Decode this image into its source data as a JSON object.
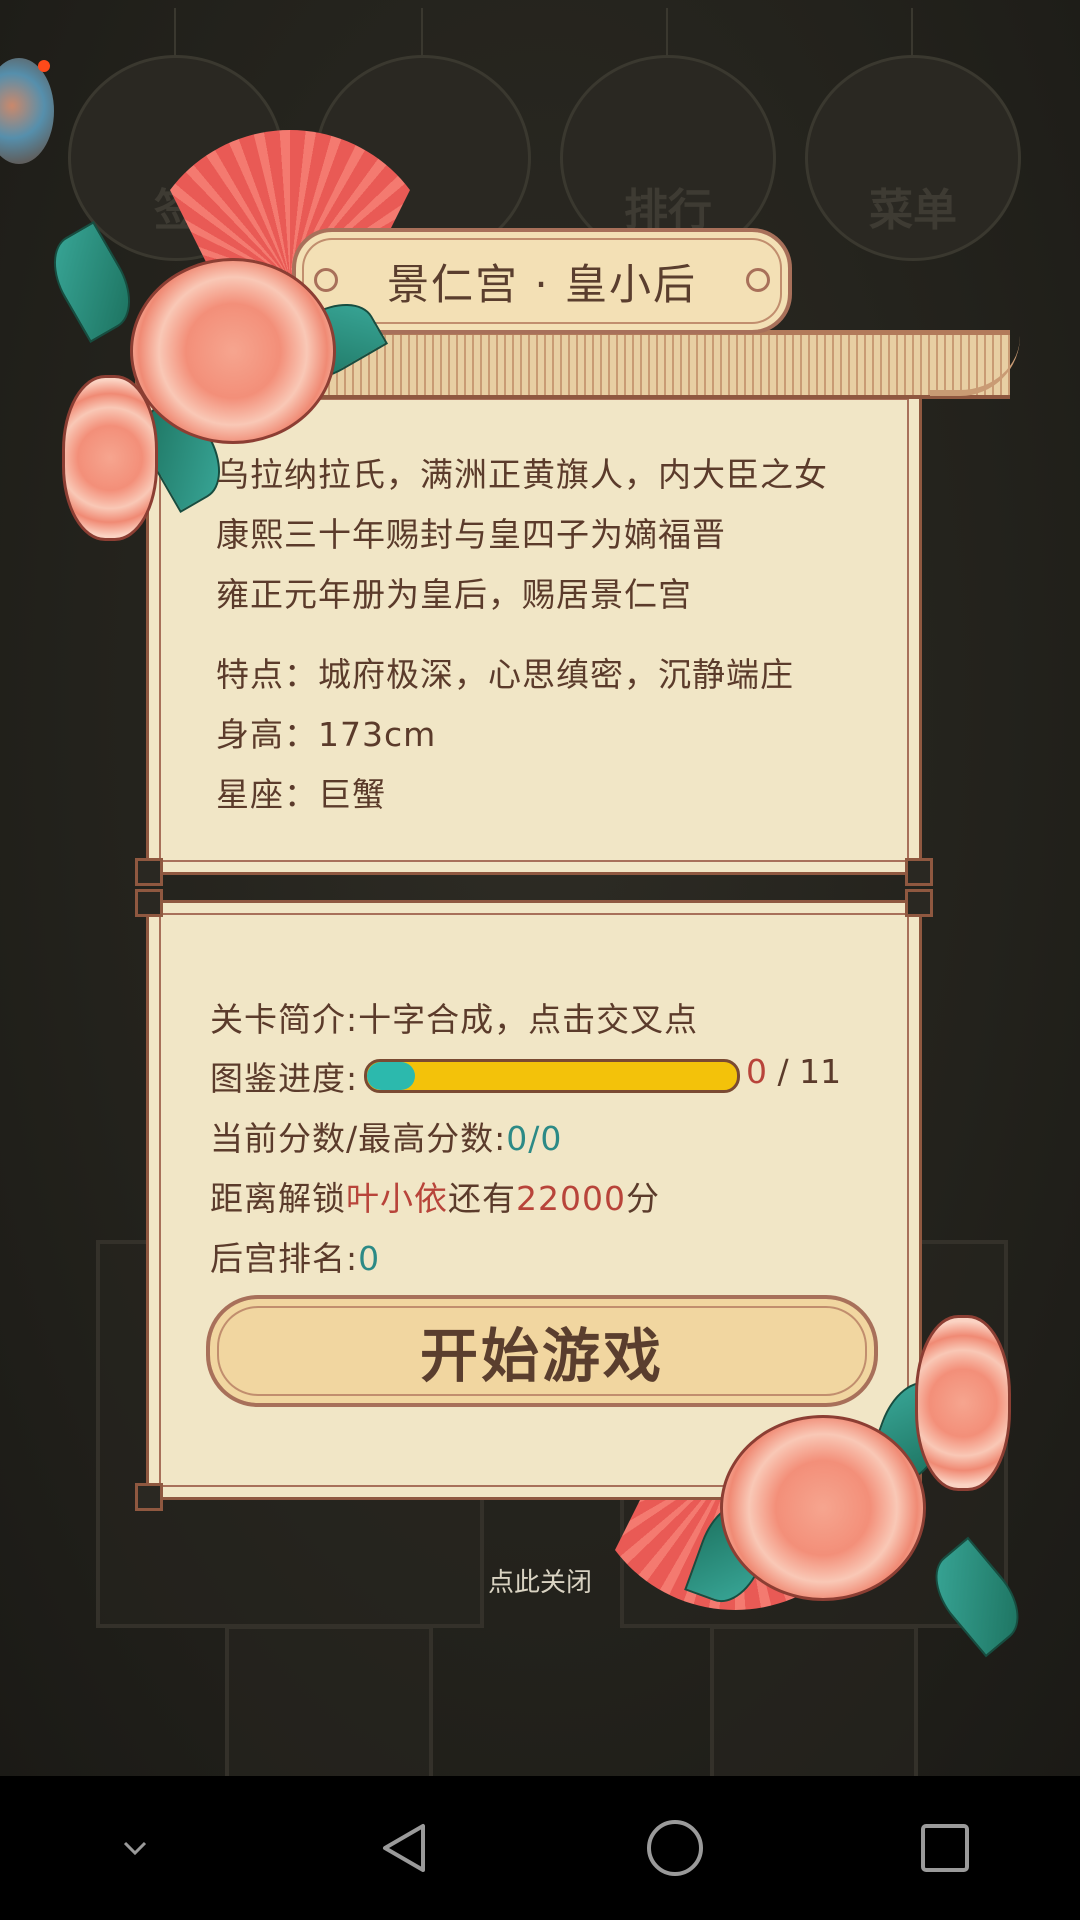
{
  "background": {
    "lanterns": [
      "签",
      "",
      "排行",
      "菜单"
    ]
  },
  "header": {
    "title": "景仁宫 · 皇小后"
  },
  "bio": {
    "line1": "乌拉纳拉氏，满洲正黄旗人，内大臣之女",
    "line2": "康熙三十年赐封与皇四子为嫡福晋",
    "line3": "雍正元年册为皇后，赐居景仁宫",
    "trait": "特点：城府极深，心思缜密，沉静端庄",
    "height": "身高：173cm",
    "zodiac": "星座：巨蟹"
  },
  "level": {
    "intro_label": "关卡简介:",
    "intro_text": "十字合成，点击交叉点",
    "progress_label": "图鉴进度:",
    "progress_current": "0",
    "progress_sep": " / ",
    "progress_total": "11",
    "progress_fill_fraction": 0.13,
    "score_label": "当前分数/最高分数:",
    "score_value": "0/0",
    "unlock_prefix": "距离解锁",
    "unlock_name": "叶小依",
    "unlock_mid": "还有",
    "unlock_points": "22000",
    "unlock_suffix": "分",
    "rank_label": "后宫排名:",
    "rank_value": "0"
  },
  "actions": {
    "start_label": "开始游戏",
    "close_label": "点此关闭"
  },
  "colors": {
    "panel": "#f1e6c6",
    "border": "#8f5840",
    "teal": "#2c8a86",
    "red": "#b8443a",
    "progress_bar": "#f3c20a",
    "progress_fill": "#2cb9ad"
  },
  "navbar": {
    "icons": [
      "chevron-down-icon",
      "back-icon",
      "home-icon",
      "recents-icon"
    ]
  }
}
